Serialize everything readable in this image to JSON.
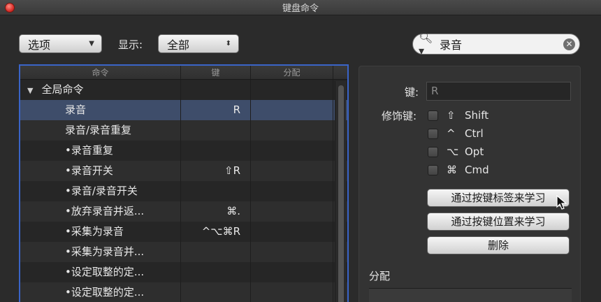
{
  "window": {
    "title": "键盘命令"
  },
  "toolbar": {
    "options_label": "选项",
    "show_label": "显示:",
    "show_value": "全部",
    "search_value": "录音"
  },
  "table": {
    "headers": [
      "命令",
      "键",
      "分配"
    ],
    "rows": [
      {
        "name": "全局命令",
        "key": "",
        "group": true
      },
      {
        "name": "录音",
        "key": "R",
        "selected": true
      },
      {
        "name": "录音/录音重复",
        "key": ""
      },
      {
        "name": "•录音重复",
        "key": ""
      },
      {
        "name": "•录音开关",
        "key": "⇧R"
      },
      {
        "name": "•录音/录音开关",
        "key": ""
      },
      {
        "name": "•放弃录音并返...",
        "key": "⌘."
      },
      {
        "name": "•采集为录音",
        "key": "^⌥⌘R"
      },
      {
        "name": "•采集为录音并...",
        "key": ""
      },
      {
        "name": "•设定取整的定...",
        "key": ""
      },
      {
        "name": "•设定取整的定...",
        "key": ""
      }
    ]
  },
  "panel": {
    "key_label": "键:",
    "key_value": "R",
    "modifier_label": "修饰键:",
    "modifiers": [
      {
        "symbol": "⇧",
        "name": "Shift"
      },
      {
        "symbol": "^",
        "name": "Ctrl"
      },
      {
        "symbol": "⌥",
        "name": "Opt"
      },
      {
        "symbol": "⌘",
        "name": "Cmd"
      }
    ],
    "learn_by_label": "通过按键标签来学习",
    "learn_by_position": "通过按键位置来学习",
    "delete": "删除",
    "assign_label": "分配"
  }
}
